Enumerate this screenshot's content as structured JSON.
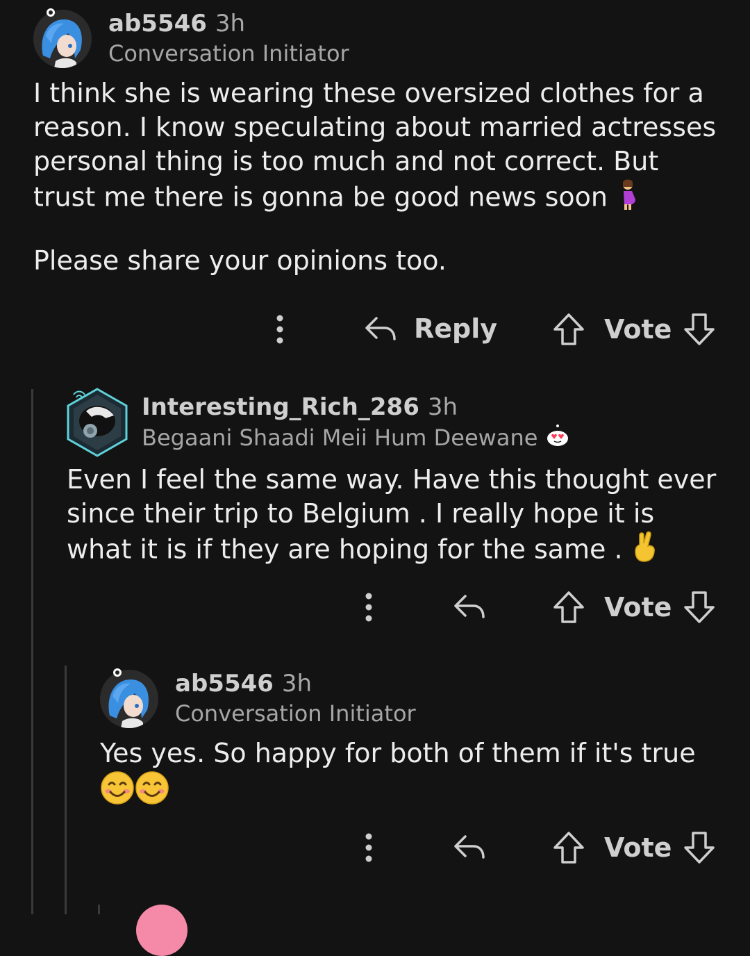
{
  "comments": [
    {
      "username": "ab5546",
      "time": "3h",
      "flair": "Conversation Initiator",
      "paragraphs": [
        "I think she is wearing these oversized clothes for a reason. I know speculating about married actresses personal thing is too much and not correct. But trust me there is gonna be good news soon",
        "Please share your opinions too."
      ],
      "reply_label": "Reply",
      "vote_label": "Vote"
    },
    {
      "username": "Interesting_Rich_286",
      "time": "3h",
      "flair": "Begaani Shaadi Meii Hum Deewane",
      "body": "Even I feel the same way. Have this thought ever since their trip to Belgium . I really hope it is what it is if they are hoping for the same .",
      "vote_label": "Vote"
    },
    {
      "username": "ab5546",
      "time": "3h",
      "flair": "Conversation Initiator",
      "body": "Yes yes. So happy for both of them if it's true",
      "vote_label": "Vote"
    }
  ],
  "icons": [
    "more-icon",
    "reply-icon",
    "upvote-icon",
    "downvote-icon",
    "pregnant-emoji",
    "crossed-fingers-emoji",
    "smiling-emoji"
  ],
  "colors": {
    "background": "#131313",
    "text": "#ededed",
    "muted": "#a6a6a6",
    "thread_line": "#3a3a3a"
  }
}
